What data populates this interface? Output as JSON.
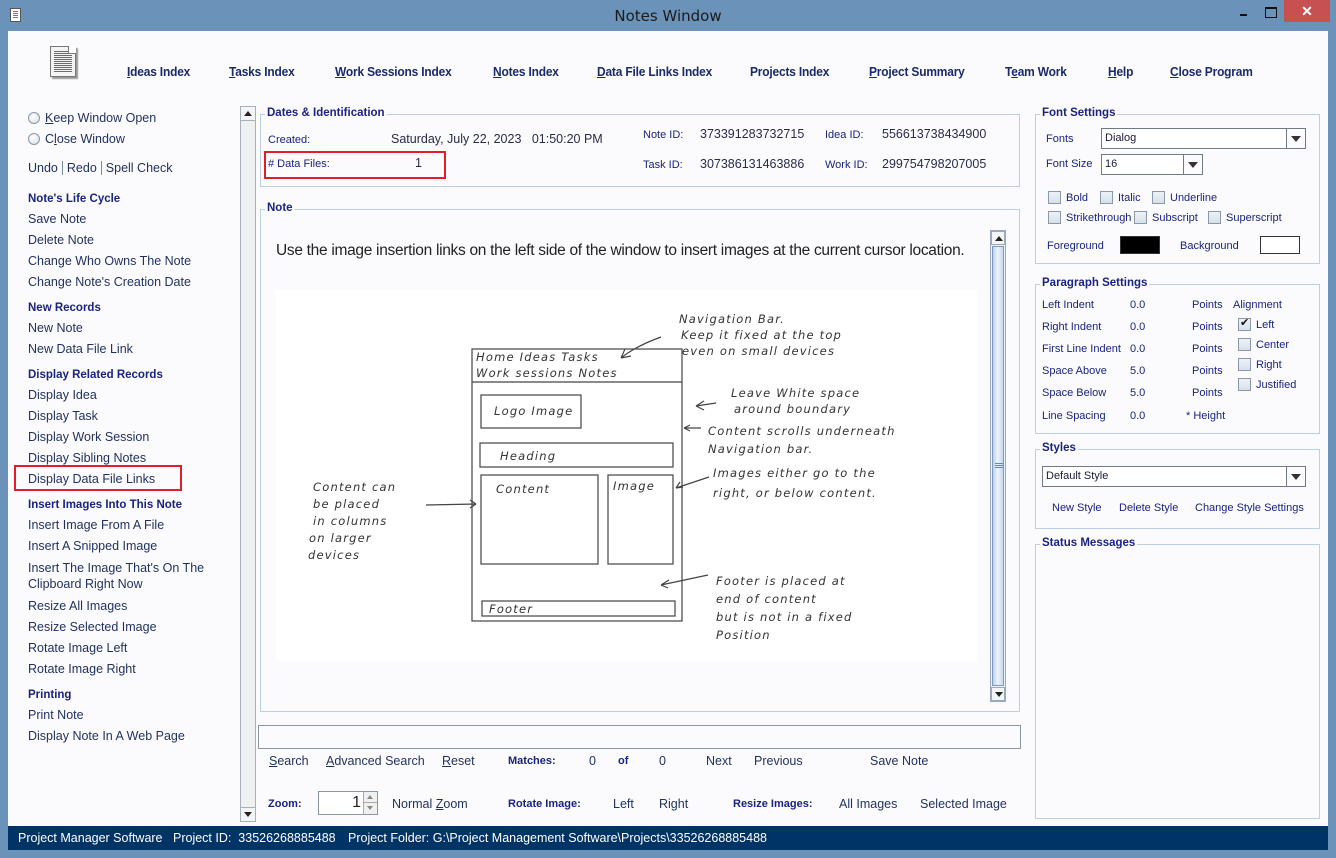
{
  "window": {
    "title": "Notes Window",
    "controls": {
      "minimize": "minimize",
      "maximize": "maximize",
      "close": "✕"
    }
  },
  "nav": [
    {
      "label": "Ideas Index",
      "mnemonic": "I"
    },
    {
      "label": "Tasks Index",
      "mnemonic": "T"
    },
    {
      "label": "Work Sessions Index",
      "mnemonic": "W"
    },
    {
      "label": "Notes Index",
      "mnemonic": "N"
    },
    {
      "label": "Data File Links Index",
      "mnemonic": "D"
    },
    {
      "label": "Projects Index",
      "mnemonic": ""
    },
    {
      "label": "Project Summary",
      "mnemonic": "P"
    },
    {
      "label": "Team Work",
      "mnemonic": "e"
    },
    {
      "label": "Help",
      "mnemonic": "H"
    },
    {
      "label": "Close Program",
      "mnemonic": "C"
    }
  ],
  "left": {
    "radios": [
      {
        "label": "Keep Window Open",
        "selected": false
      },
      {
        "label": "Close Window",
        "selected": false
      }
    ],
    "edit_links": [
      "Undo",
      "Redo",
      "Spell Check"
    ],
    "sections": [
      {
        "heading": "Note's Life Cycle",
        "items": [
          "Save Note",
          "Delete Note",
          "Change Who Owns The Note",
          "Change Note's Creation Date"
        ]
      },
      {
        "heading": "New Records",
        "items": [
          "New Note",
          "New Data File Link"
        ]
      },
      {
        "heading": "Display Related Records",
        "items": [
          "Display Idea",
          "Display Task",
          "Display Work Session",
          "Display Sibling Notes",
          "Display Data File Links"
        ]
      },
      {
        "heading": "Insert Images Into This Note",
        "items": [
          "Insert Image From A File",
          "Insert A Snipped Image",
          "Insert The Image That's On The",
          "Clipboard Right Now",
          "Resize All Images",
          "Resize Selected Image",
          "Rotate Image Left",
          "Rotate Image Right"
        ]
      },
      {
        "heading": "Printing",
        "items": [
          "Print Note",
          "Display Note In A Web Page"
        ]
      }
    ]
  },
  "dates": {
    "title": "Dates & Identification",
    "created_label": "Created:",
    "created_value": "Saturday, July 22, 2023   01:50:20 PM",
    "data_files_label": "# Data Files:",
    "data_files_value": "1",
    "note_id_label": "Note ID:",
    "note_id": "373391283732715",
    "idea_id_label": "Idea ID:",
    "idea_id": "556613738434900",
    "task_id_label": "Task ID:",
    "task_id": "307386131463886",
    "work_id_label": "Work ID:",
    "work_id": "299754798207005"
  },
  "note": {
    "title": "Note",
    "text": "Use the image insertion links on the left side of the window to insert images at the current cursor location.",
    "sketch": {
      "nav_items_line1": "Home   Ideas   Tasks",
      "nav_items_line2": "Work sessions    Notes",
      "logo": "Logo  Image",
      "heading": "Heading",
      "content": "Content",
      "image": "Image",
      "footer": "Footer",
      "annotations": {
        "nav": [
          "Navigation Bar.",
          "Keep it fixed at the top",
          "even on small devices"
        ],
        "whitespace": [
          "Leave White space",
          "around boundary"
        ],
        "scroll": [
          "Content  scrolls  underneath",
          "Navigation  bar."
        ],
        "images": [
          "Images  either  go  to the",
          "right, or  below  content."
        ],
        "columns": [
          "Content can",
          "be placed",
          "in columns",
          "on larger",
          "devices"
        ],
        "footer": [
          "Footer is placed at",
          "end of content",
          "but is not in a fixed",
          "Position"
        ]
      }
    }
  },
  "search": {
    "input_value": "",
    "search": "Search",
    "advanced": "Advanced Search",
    "reset": "Reset",
    "matches_label": "Matches:",
    "matches": "0",
    "of_label": "of",
    "total": "0",
    "next": "Next",
    "previous": "Previous",
    "save_note": "Save Note"
  },
  "zoombar": {
    "zoom_label": "Zoom:",
    "zoom_value": "1",
    "normal_zoom": "Normal Zoom",
    "rotate_label": "Rotate Image:",
    "rotate_left": "Left",
    "rotate_right": "Right",
    "resize_label": "Resize Images:",
    "all_images": "All Images",
    "selected_image": "Selected Image"
  },
  "font_settings": {
    "title": "Font Settings",
    "fonts_label": "Fonts",
    "font_value": "Dialog",
    "size_label": "Font Size",
    "size_value": "16",
    "bold": "Bold",
    "italic": "Italic",
    "underline": "Underline",
    "strikethrough": "Strikethrough",
    "subscript": "Subscript",
    "superscript": "Superscript",
    "foreground_label": "Foreground",
    "foreground_color": "#000000",
    "background_label": "Background",
    "background_color": "#ffffff"
  },
  "paragraph": {
    "title": "Paragraph Settings",
    "rows": [
      {
        "label": "Left Indent",
        "value": "0.0",
        "unit": "Points"
      },
      {
        "label": "Right Indent",
        "value": "0.0",
        "unit": "Points"
      },
      {
        "label": "First Line Indent",
        "value": "0.0",
        "unit": "Points"
      },
      {
        "label": "Space Above",
        "value": "5.0",
        "unit": "Points"
      },
      {
        "label": "Space Below",
        "value": "5.0",
        "unit": "Points"
      },
      {
        "label": "Line Spacing",
        "value": "0.0",
        "unit": "* Height"
      }
    ],
    "alignment_label": "Alignment",
    "alignments": [
      {
        "label": "Left",
        "checked": true
      },
      {
        "label": "Center",
        "checked": false
      },
      {
        "label": "Right",
        "checked": false
      },
      {
        "label": "Justified",
        "checked": false
      }
    ]
  },
  "styles": {
    "title": "Styles",
    "selected": "Default Style",
    "new": "New Style",
    "delete": "Delete Style",
    "change": "Change Style Settings"
  },
  "status_messages": {
    "title": "Status Messages"
  },
  "statusbar": {
    "app": "Project Manager Software",
    "project_id": "Project ID:  33526268885488",
    "folder": "Project Folder: G:\\Project Management Software\\Projects\\33526268885488"
  },
  "colors": {
    "accent_text": "#1a237e",
    "statusbar": "#003366",
    "highlight": "#e11d2a",
    "title_bg": "#6b93b9"
  }
}
